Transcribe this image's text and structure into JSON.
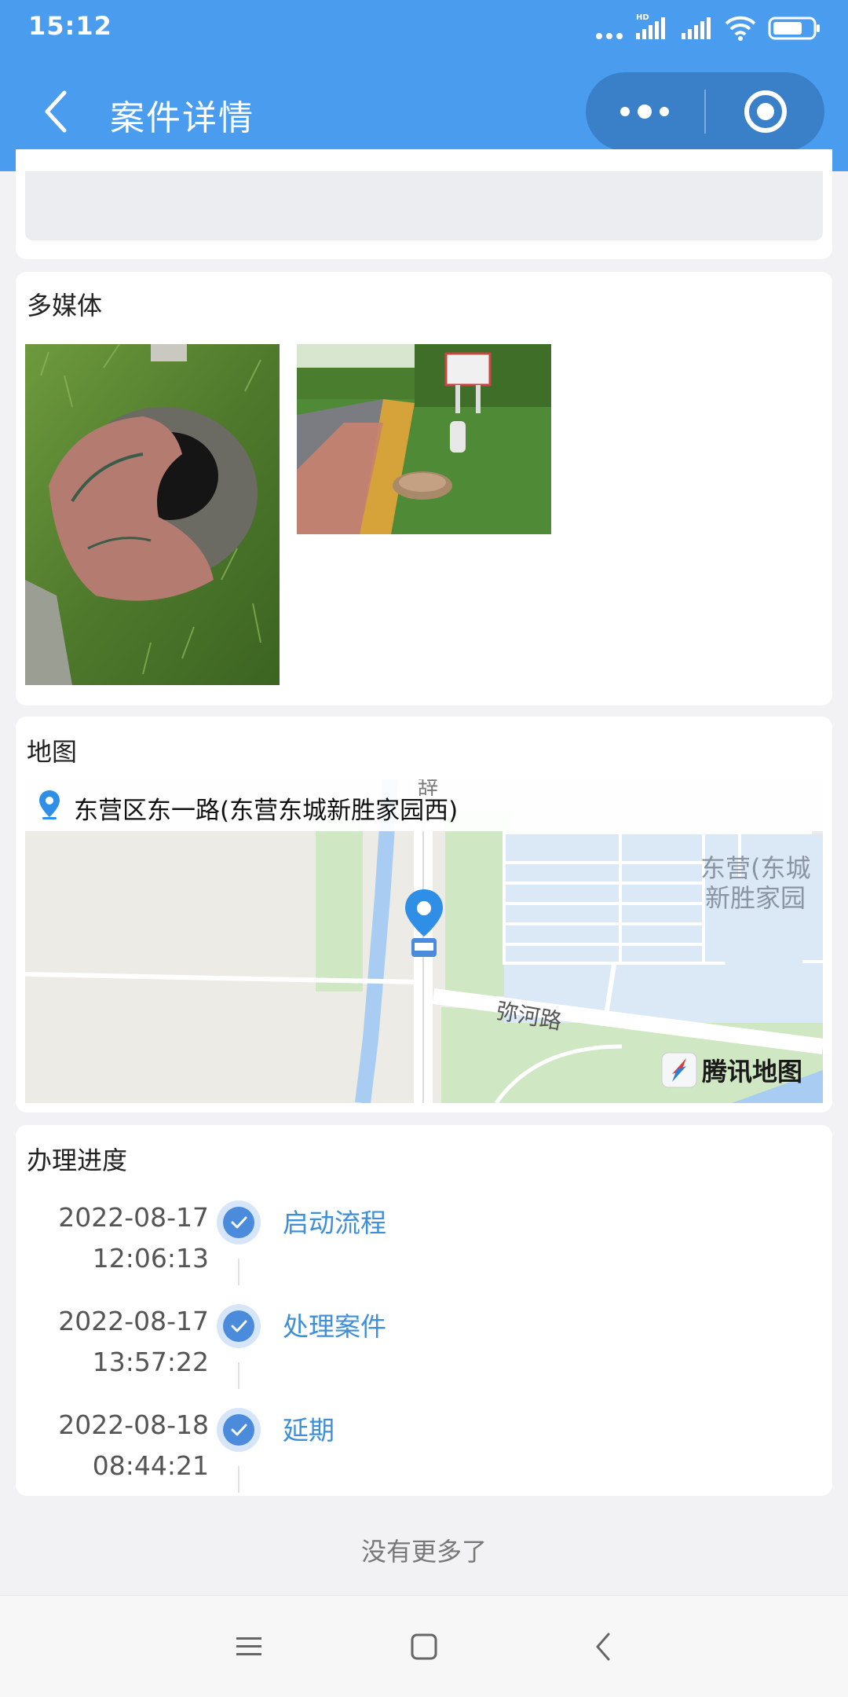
{
  "status_bar": {
    "time": "15:12",
    "icons": [
      "dots-icon",
      "signal-hd-icon",
      "signal-icon",
      "wifi-icon",
      "battery-icon"
    ]
  },
  "nav_bar": {
    "title": "案件详情",
    "back_icon": "back-icon",
    "menu_icon": "more-icon",
    "close_icon": "target-icon"
  },
  "media": {
    "title": "多媒体",
    "photos": [
      "photo-manhole-closeup",
      "photo-roadside-manhole"
    ]
  },
  "map": {
    "title": "地图",
    "address": "东营区东一路(东营东城新胜家园西)",
    "road_label": "弥河路",
    "area_label_1": "东营(东城",
    "area_label_2": "新胜家园",
    "north_label": "辞",
    "logo_text": "腾讯地图"
  },
  "progress": {
    "title": "办理进度",
    "steps": [
      {
        "date": "2022-08-17",
        "time": "12:06:13",
        "label": "启动流程"
      },
      {
        "date": "2022-08-17",
        "time": "13:57:22",
        "label": "处理案件"
      },
      {
        "date": "2022-08-18",
        "time": "08:44:21",
        "label": "延期"
      }
    ]
  },
  "footer": {
    "no_more": "没有更多了"
  },
  "system_nav": {
    "icons": [
      "menu-icon",
      "home-icon",
      "back-icon"
    ]
  },
  "colors": {
    "header": "#4a9cee",
    "capsule": "#3a80c8",
    "accent": "#3f8fd8",
    "page_bg": "#f2f2f4"
  }
}
